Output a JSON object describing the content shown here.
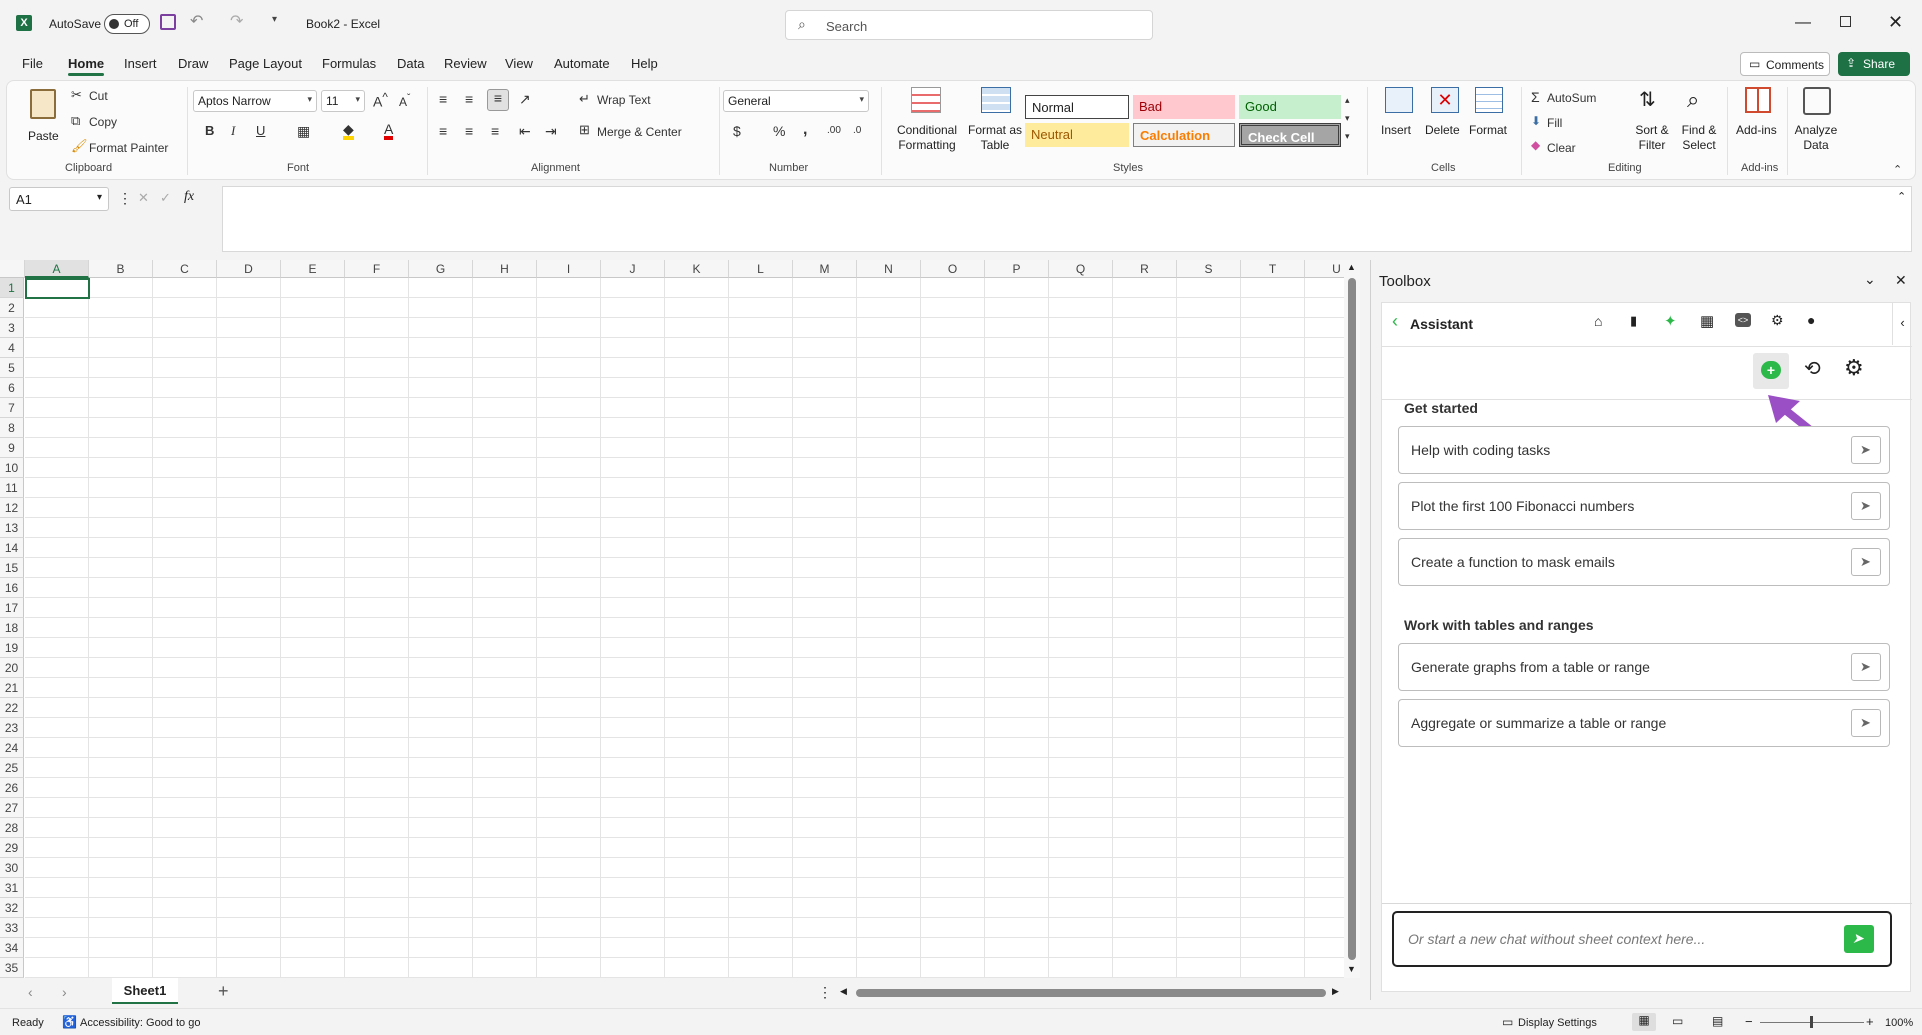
{
  "titlebar": {
    "autosave_label": "AutoSave",
    "autosave_state": "Off",
    "window_title": "Book2 - Excel",
    "search_placeholder": "Search"
  },
  "menu": {
    "items": [
      "File",
      "Home",
      "Insert",
      "Draw",
      "Page Layout",
      "Formulas",
      "Data",
      "Review",
      "View",
      "Automate",
      "Help"
    ],
    "active": "Home",
    "comments_label": "Comments",
    "share_label": "Share"
  },
  "ribbon": {
    "clipboard": {
      "title": "Clipboard",
      "paste": "Paste",
      "cut": "Cut",
      "copy": "Copy",
      "format_painter": "Format Painter"
    },
    "font": {
      "title": "Font",
      "family": "Aptos Narrow",
      "size": "11"
    },
    "alignment": {
      "title": "Alignment",
      "wrap_text": "Wrap Text",
      "merge_center": "Merge & Center"
    },
    "number": {
      "title": "Number",
      "format": "General"
    },
    "styles": {
      "title": "Styles",
      "conditional_formatting": "Conditional Formatting",
      "format_as_table": "Format as Table",
      "normal": "Normal",
      "bad": "Bad",
      "good": "Good",
      "neutral": "Neutral",
      "calculation": "Calculation",
      "check_cell": "Check Cell"
    },
    "cells": {
      "title": "Cells",
      "insert": "Insert",
      "delete": "Delete",
      "format": "Format"
    },
    "editing": {
      "title": "Editing",
      "autosum": "AutoSum",
      "fill": "Fill",
      "clear": "Clear",
      "sort_filter": "Sort & Filter",
      "find_select": "Find & Select"
    },
    "addins": {
      "title": "Add-ins",
      "addins": "Add-ins",
      "analyze_data": "Analyze Data"
    }
  },
  "formula_bar": {
    "name_box": "A1",
    "fx": "fx"
  },
  "grid": {
    "columns": [
      "A",
      "B",
      "C",
      "D",
      "E",
      "F",
      "G",
      "H",
      "I",
      "J",
      "K",
      "L",
      "M",
      "N",
      "O",
      "P",
      "Q",
      "R",
      "S",
      "T",
      "U"
    ],
    "rows": [
      "1",
      "2",
      "3",
      "4",
      "5",
      "6",
      "7",
      "8",
      "9",
      "10",
      "11",
      "12",
      "13",
      "14",
      "15",
      "16",
      "17",
      "18",
      "19",
      "20",
      "21",
      "22",
      "23",
      "24",
      "25",
      "26",
      "27",
      "28",
      "29",
      "30",
      "31",
      "32",
      "33",
      "34",
      "35"
    ]
  },
  "sheets": {
    "tabs": [
      "Sheet1"
    ],
    "active": "Sheet1"
  },
  "statusbar": {
    "ready": "Ready",
    "accessibility": "Accessibility: Good to go",
    "display_settings": "Display Settings",
    "zoom": "100%"
  },
  "toolbox": {
    "title": "Toolbox",
    "assistant_title": "Assistant",
    "get_started": "Get started",
    "get_started_prompts": [
      "Help with coding tasks",
      "Plot the first 100 Fibonacci numbers",
      "Create a function to mask emails"
    ],
    "tables_title": "Work with tables and ranges",
    "tables_prompts": [
      "Generate graphs from a table or range",
      "Aggregate or summarize a table or range"
    ],
    "chat_placeholder": "Or start a new chat without sheet context here...",
    "accent_color": "#2db84a",
    "arrow_color": "#9b4fc4"
  }
}
